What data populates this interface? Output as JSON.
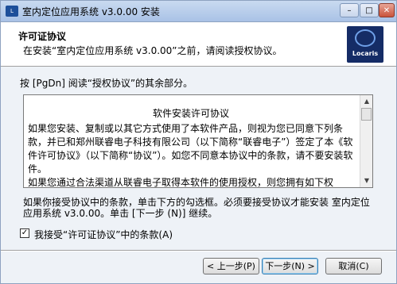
{
  "window": {
    "title": "室内定位应用系统 v3.0.00 安装",
    "app_icon_text": "Locaris",
    "minimize_symbol": "–",
    "maximize_symbol": "□",
    "close_symbol": "✕"
  },
  "header": {
    "title": "许可证协议",
    "subtitle": "在安装“室内定位应用系统 v3.0.00”之前，请阅读授权协议。",
    "logo_text": "Locaris"
  },
  "instruction": "按 [PgDn] 阅读“授权协议”的其余部分。",
  "license": {
    "heading": "软件安装许可协议",
    "paragraphs": [
      "如果您安装、复制或以其它方式使用了本软件产品，则视为您已同意下列条款，并已和郑州联睿电子科技有限公司（以下简称“联睿电子”）签定了本《软件许可协议》（以下简称“协议”）。如您不同意本协议中的条款，请不要安装软件。",
      "如果您通过合法渠道从联睿电子取得本软件的使用授权，则您拥有如下权"
    ],
    "scroll_up": "▲",
    "scroll_down": "▼"
  },
  "accept_note": "如果你接受协议中的条款，单击下方的勾选框。必须要接受协议才能安装 室内定位应用系统 v3.0.00。单击 [下一步 (N)] 继续。",
  "checkbox": {
    "checked_mark": "✓",
    "label": "我接受“许可证协议”中的条款(A)"
  },
  "buttons": {
    "back": "< 上一步(P)",
    "next": "下一步(N) >",
    "cancel": "取消(C)"
  },
  "colors": {
    "titlebar": "#a9c2e6",
    "window_bg": "#eef2f7",
    "logo_bg": "#152c66"
  }
}
